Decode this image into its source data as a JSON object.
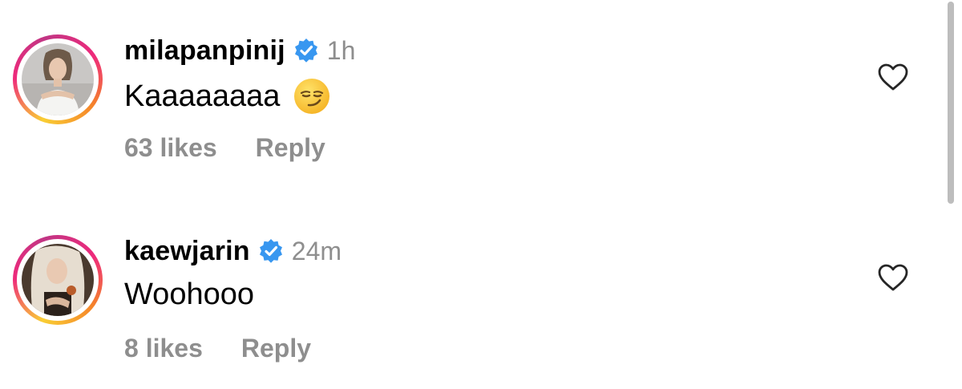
{
  "comments": [
    {
      "username": "milapanpinij",
      "time": "1h",
      "text": "Kaaaaaaaa",
      "emoji": "smirking-face",
      "likes": "63 likes",
      "reply": "Reply",
      "verified": true
    },
    {
      "username": "kaewjarin",
      "time": "24m",
      "text": "Woohooo",
      "likes": "8 likes",
      "reply": "Reply",
      "verified": true
    }
  ],
  "colors": {
    "verified_blue": "#3897f0",
    "muted_text": "#8e8e8e",
    "story_ring": [
      "#f9ce34",
      "#ee2a7b",
      "#c13584"
    ]
  },
  "icons": {
    "like": "heart-outline-icon",
    "verified": "verified-badge-icon"
  }
}
